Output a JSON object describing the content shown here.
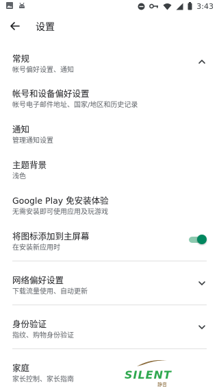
{
  "status_bar": {
    "time": "3:43"
  },
  "app_bar": {
    "title": "设置"
  },
  "settings": [
    {
      "title": "常规",
      "subtitle": "帐号偏好设置、通知"
    },
    {
      "title": "帐号和设备偏好设置",
      "subtitle": "帐号电子邮件地址、国家/地区和历史记录"
    },
    {
      "title": "通知",
      "subtitle": "管理通知设置"
    },
    {
      "title": "主题背景",
      "subtitle": "浅色"
    },
    {
      "title": "Google Play 免安装体验",
      "subtitle": "无需安装即可使用应用及玩游戏"
    },
    {
      "title": "将图标添加到主屏幕",
      "subtitle": "在安装新应用时",
      "toggle_on": true
    },
    {
      "title": "网络偏好设置",
      "subtitle": "下载流量使用、自动更新"
    },
    {
      "title": "身份验证",
      "subtitle": "指纹、购物身份验证"
    },
    {
      "title": "家庭",
      "subtitle": "家长控制、家长指南"
    }
  ],
  "watermark": {
    "text": "SILENT",
    "small_text": "静音"
  },
  "colors": {
    "accent": "#01875f",
    "accent_light": "#8dcab0",
    "text": "#202124",
    "subtext": "#5f6368"
  }
}
